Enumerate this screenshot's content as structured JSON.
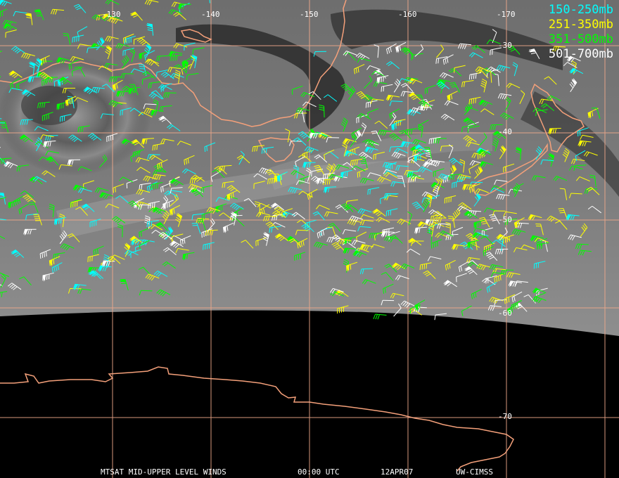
{
  "map": {
    "longitude_labels": [
      "-130",
      "-140",
      "-150",
      "-160",
      "-170"
    ],
    "latitude_labels": [
      "-30",
      "-40",
      "-50",
      "-60",
      "-70"
    ]
  },
  "legend": {
    "items": [
      {
        "label": "150-250mb",
        "color": "#00ffff"
      },
      {
        "label": "251-350mb",
        "color": "#ffff00"
      },
      {
        "label": "351-500mb",
        "color": "#00ff00"
      },
      {
        "label": "501-700mb",
        "color": "#ffffff"
      }
    ]
  },
  "footer": {
    "product": "MTSAT MID-UPPER LEVEL WINDS",
    "time": "00:00 UTC",
    "date": "12APR07",
    "source": "UW-CIMSS"
  },
  "colors": {
    "coastline": "#f4a07a",
    "grid": "#f0a88a",
    "background": "#000000"
  }
}
